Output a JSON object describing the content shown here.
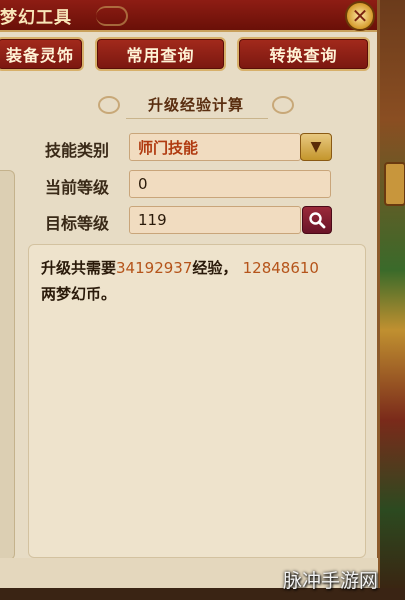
{
  "window": {
    "title": "梦幻工具",
    "close_icon": "close-icon"
  },
  "tabs": [
    {
      "label": "装备灵饰"
    },
    {
      "label": "常用查询"
    },
    {
      "label": "转换查询"
    }
  ],
  "section": {
    "heading": "升级经验计算"
  },
  "form": {
    "skill_type": {
      "label": "技能类别",
      "value": "师门技能"
    },
    "current_level": {
      "label": "当前等级",
      "value": "0"
    },
    "target_level": {
      "label": "目标等级",
      "value": "119"
    }
  },
  "result": {
    "prefix": "升级共需要",
    "exp": "34192937",
    "mid": "经验，",
    "coins": "12848610",
    "suffix": "两梦幻币。"
  },
  "watermark": "脉冲手游网",
  "colors": {
    "accent": "#8e1d14",
    "panel": "#e7dcc5",
    "highlight": "#b5541a"
  }
}
